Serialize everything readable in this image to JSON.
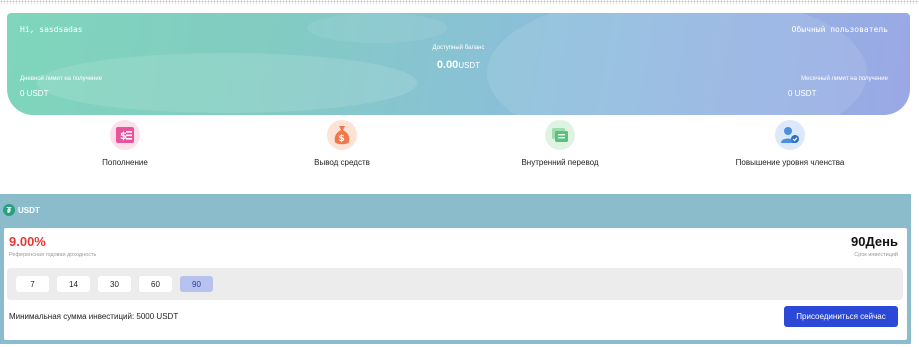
{
  "header": {
    "greeting": "Hi,  sasdsadas",
    "user_type": "Обычный пользователь",
    "balance_label": "Доступный баланс",
    "balance_amount": "0.00",
    "balance_unit": "USDT",
    "daily_limit_label": "Дневной лимит на получение",
    "daily_limit_value": "0 USDT",
    "monthly_limit_label": "Месячный лимит на получение",
    "monthly_limit_value": "0 USDT"
  },
  "actions": [
    {
      "label": "Пополнение",
      "icon": "deposit-icon",
      "color": "#e8539a"
    },
    {
      "label": "Вывод средств",
      "icon": "withdraw-icon",
      "color": "#f2784b"
    },
    {
      "label": "Внутренний перевод",
      "icon": "transfer-icon",
      "color": "#58c27a"
    },
    {
      "label": "Повышение уровня членства",
      "icon": "membership-upgrade-icon",
      "color": "#4a8fe0"
    }
  ],
  "product": {
    "coin": "USDT",
    "coin_icon": "tether-icon",
    "rate": "9.00%",
    "rate_label": "Референсная годовая доходность",
    "term": "90День",
    "term_label": "Срок инвестиций",
    "day_options": [
      "7",
      "14",
      "30",
      "60",
      "90"
    ],
    "selected_day": "90",
    "min_amount": "Минимальная сумма инвестиций:  5000 USDT",
    "join_label": "Присоединиться сейчас"
  },
  "colors": {
    "accent": "#2b48d6",
    "rate_red": "#e53935",
    "panel_bg": "#8bbccc"
  }
}
